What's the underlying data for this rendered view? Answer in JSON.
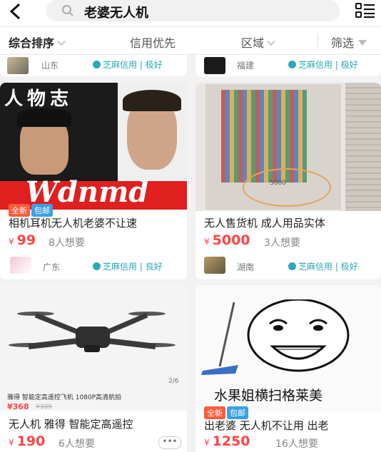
{
  "search": {
    "query": "老婆无人机"
  },
  "filters": {
    "items": [
      "综合排序",
      "信用优先",
      "区域",
      "筛选"
    ]
  },
  "top_sellers": [
    {
      "location": "山东",
      "credit": "芝麻信用 | 极好"
    },
    {
      "location": "福建",
      "credit": "芝麻信用 | 极好"
    }
  ],
  "products": [
    {
      "image_text_top": "人物志",
      "image_text_brand": "Wdnmd",
      "tags": [
        "全新",
        "包邮"
      ],
      "title": "相机耳机无人机老婆不让速",
      "currency": "¥",
      "price": "99",
      "wants": "8人想要",
      "location": "广东",
      "credit": "芝麻信用 | 良好"
    },
    {
      "image_text": "5000",
      "title": "无人售货机 成人用品实体",
      "currency": "¥",
      "price": "5000",
      "wants": "3人想要",
      "location": "湖南",
      "credit": "芝麻信用 | 极好"
    },
    {
      "image_caption": "雅得 智能定高遥控飞机 1080P高清航拍",
      "image_price": "¥368",
      "image_old_price": "¥399",
      "image_index": "2/6",
      "title": "无人机 雅得 智能定高遥控",
      "currency": "¥",
      "price": "190",
      "wants": "6人想要",
      "more": "•••"
    },
    {
      "image_caption": "水果姐横扫格莱美",
      "tags": [
        "全新",
        "包邮"
      ],
      "title": "出老婆 无人机不让用 出老",
      "currency": "¥",
      "price": "1250",
      "wants": "16人想要"
    }
  ],
  "colors": {
    "accent": "#ff4444",
    "credit": "#2aa9b8",
    "tag_new": "#ff5a3c",
    "tag_ship": "#3aa0e8"
  }
}
